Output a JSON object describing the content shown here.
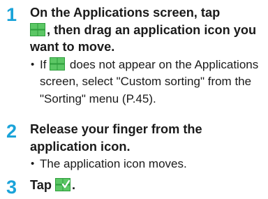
{
  "steps": [
    {
      "number": "1",
      "heading_part1": "On the Applications screen, tap",
      "heading_icon": "grid-sort-icon",
      "heading_part2": ", then drag an application icon you want to move.",
      "note_part1": "If",
      "note_icon": "grid-sort-icon",
      "note_part2": "does not appear on the Applications screen, select \"Custom sorting\" from the \"Sorting\" menu (P.45)."
    },
    {
      "number": "2",
      "heading": "Release your finger from the application icon.",
      "note": "The application icon moves."
    },
    {
      "number": "3",
      "heading_part1": "Tap",
      "heading_icon": "grid-check-icon",
      "heading_part2": "."
    }
  ],
  "colors": {
    "step_number": "#1aa3d9",
    "icon_green": "#3fb04a"
  },
  "bullet_char": "•"
}
